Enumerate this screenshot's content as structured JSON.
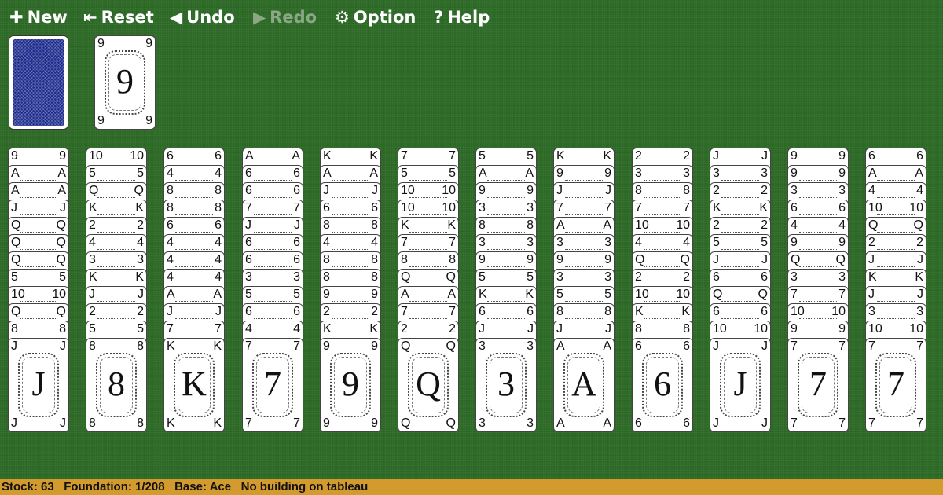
{
  "toolbar": {
    "buttons": [
      {
        "id": "new",
        "label": "New",
        "icon": "plus-icon",
        "glyph": "✚",
        "enabled": true
      },
      {
        "id": "reset",
        "label": "Reset",
        "icon": "reset-icon",
        "glyph": "⇤",
        "enabled": true
      },
      {
        "id": "undo",
        "label": "Undo",
        "icon": "undo-icon",
        "glyph": "◀",
        "enabled": true
      },
      {
        "id": "redo",
        "label": "Redo",
        "icon": "redo-icon",
        "glyph": "▶",
        "enabled": false
      },
      {
        "id": "option",
        "label": "Option",
        "icon": "gear-icon",
        "glyph": "⚙",
        "enabled": true
      },
      {
        "id": "help",
        "label": "Help",
        "icon": "help-icon",
        "glyph": "?",
        "enabled": true
      }
    ]
  },
  "stock": {
    "face": "down"
  },
  "waste": {
    "rank": "9"
  },
  "tableau": [
    [
      "9",
      "A",
      "A",
      "J",
      "Q",
      "Q",
      "Q",
      "5",
      "10",
      "Q",
      "8",
      "J"
    ],
    [
      "10",
      "5",
      "Q",
      "K",
      "2",
      "4",
      "3",
      "K",
      "J",
      "2",
      "5",
      "8"
    ],
    [
      "6",
      "4",
      "8",
      "8",
      "6",
      "4",
      "4",
      "4",
      "A",
      "J",
      "7",
      "K"
    ],
    [
      "A",
      "6",
      "6",
      "7",
      "J",
      "6",
      "6",
      "3",
      "5",
      "6",
      "4",
      "7"
    ],
    [
      "K",
      "A",
      "J",
      "6",
      "8",
      "4",
      "8",
      "8",
      "9",
      "2",
      "K",
      "9"
    ],
    [
      "7",
      "5",
      "10",
      "10",
      "K",
      "7",
      "8",
      "Q",
      "A",
      "7",
      "2",
      "Q"
    ],
    [
      "5",
      "A",
      "9",
      "3",
      "8",
      "3",
      "9",
      "5",
      "K",
      "6",
      "J",
      "3"
    ],
    [
      "K",
      "9",
      "J",
      "7",
      "A",
      "3",
      "9",
      "3",
      "5",
      "8",
      "J",
      "A"
    ],
    [
      "2",
      "3",
      "8",
      "7",
      "10",
      "4",
      "Q",
      "2",
      "10",
      "K",
      "8",
      "6"
    ],
    [
      "J",
      "3",
      "2",
      "K",
      "2",
      "5",
      "J",
      "6",
      "Q",
      "6",
      "10",
      "J"
    ],
    [
      "9",
      "9",
      "3",
      "6",
      "4",
      "9",
      "Q",
      "3",
      "7",
      "10",
      "9",
      "7"
    ],
    [
      "6",
      "A",
      "4",
      "10",
      "Q",
      "2",
      "J",
      "K",
      "J",
      "3",
      "10",
      "7"
    ]
  ],
  "status": {
    "stock_label": "Stock:",
    "stock_value": "63",
    "foundation_label": "Foundation:",
    "foundation_value": "1/208",
    "base_label": "Base:",
    "base_value": "Ace",
    "rule": "No building on tableau"
  }
}
